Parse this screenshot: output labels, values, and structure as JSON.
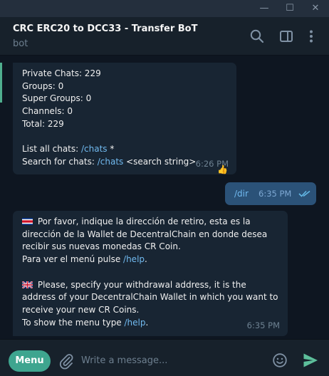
{
  "window": {
    "minimize_glyph": "—",
    "maximize_glyph": "☐",
    "close_glyph": "✕"
  },
  "header": {
    "title": "CRC ERC20 to DCC33 - Transfer BoT",
    "subtitle": "bot",
    "icons": [
      "search-icon",
      "sidebar-toggle-icon",
      "more-vertical-icon"
    ]
  },
  "messages": {
    "stats": {
      "lines": [
        "Private Chats: 229",
        "Groups: 0",
        "Super Groups: 0",
        "Channels: 0",
        "Total: 229"
      ],
      "list_all_prefix": "List all chats: ",
      "list_all_command": "/chats",
      "list_all_suffix": " *",
      "search_prefix": "Search for chats: ",
      "search_command": "/chats",
      "search_suffix": " <search string>",
      "time": "6:26 PM",
      "reaction": "👍"
    },
    "outgoing": {
      "text": "/dir",
      "time": "6:35 PM",
      "status": "read-double-check"
    },
    "info": {
      "es_flag": "costa-rica-flag-icon",
      "es_text": "Por favor, indique la dirección de retiro, esta es la dirección de la Wallet de DecentralChain en donde desea recibir sus nuevas monedas CR Coin.",
      "es_menu_prefix": "Para ver el menú pulse ",
      "es_menu_command": "/help",
      "es_menu_suffix": ".",
      "en_flag": "uk-flag-icon",
      "en_text": "Please, specify your withdrawal address, it is the address of your DecentralChain Wallet in which you want to receive your new CR Coins.",
      "en_menu_prefix": "To show the menu type ",
      "en_menu_command": "/help",
      "en_menu_suffix": ".",
      "time": "6:35 PM"
    }
  },
  "composer": {
    "menu_label": "Menu",
    "placeholder": "Write a message...",
    "icons": [
      "attach-icon",
      "emoji-icon",
      "send-icon"
    ]
  },
  "colors": {
    "background": "#0e1621",
    "header": "#17212b",
    "incoming_bubble": "#182533",
    "outgoing_bubble": "#2b5278",
    "link": "#71baf0",
    "menu_button": "#3ea58f",
    "send_icon": "#5dbf9b"
  }
}
